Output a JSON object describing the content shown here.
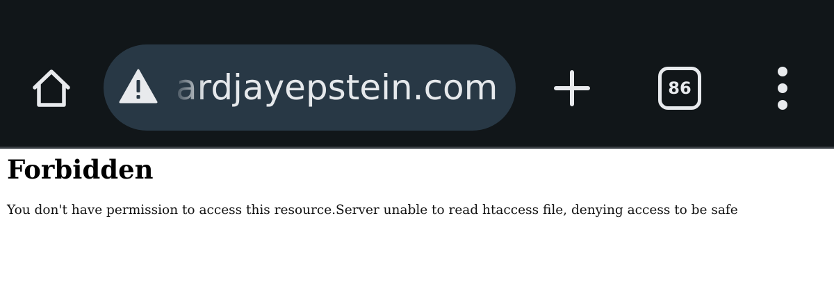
{
  "browser": {
    "address_bar": {
      "url": "ardjayepstein.com",
      "security_icon": "warning-icon"
    },
    "toolbar": {
      "home_icon": "home-icon",
      "new_tab_icon": "plus-icon",
      "tab_count": "86",
      "menu_icon": "more-vertical-icon"
    },
    "colors": {
      "toolbar_bg": "#111619",
      "omnibox_bg": "#283845",
      "icon_fg": "#e8eaed"
    }
  },
  "page": {
    "title": "Forbidden",
    "message": "You don't have permission to access this resource.Server unable to read htaccess file, denying access to be safe"
  }
}
